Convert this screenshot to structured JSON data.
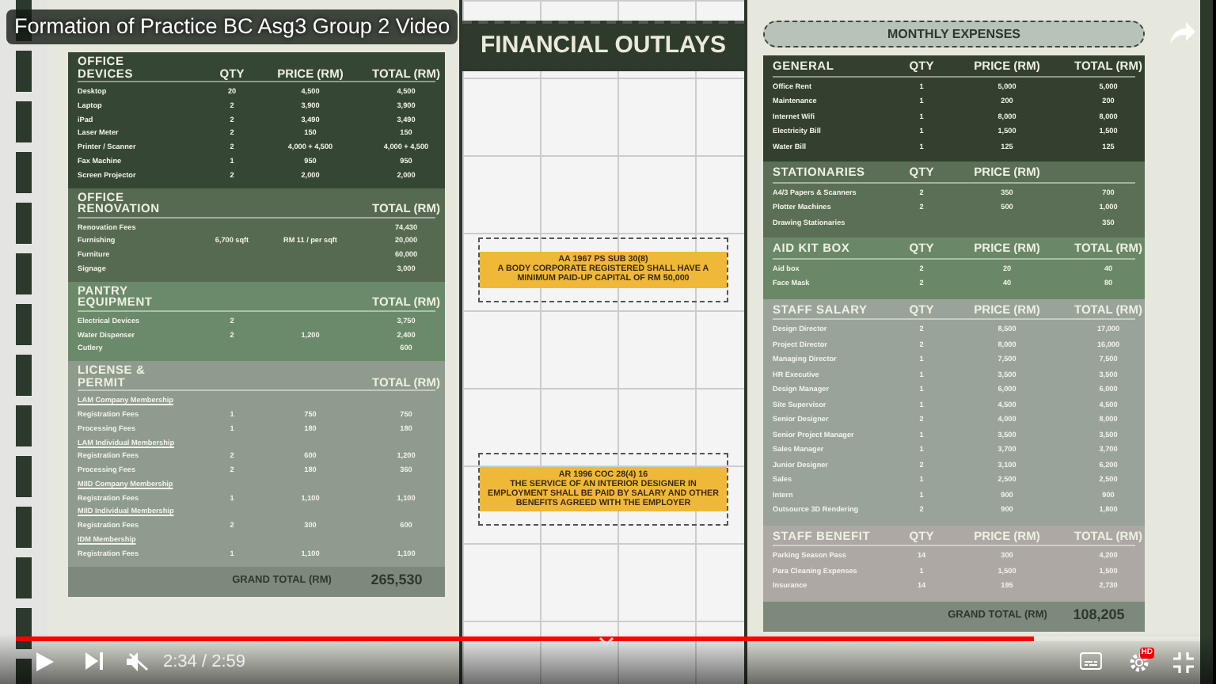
{
  "video": {
    "title": "Formation of Practice BC Asg3 Group 2 Video",
    "time": "2:34 / 2:59",
    "progress": {
      "level": 0.86
    },
    "quality_badge": "HD"
  },
  "slide": {
    "left_table": {
      "sections": [
        {
          "title": "OFFICE DEVICES",
          "color": "#354634",
          "headers": {
            "qty": "QTY",
            "price": "PRICE (RM)",
            "total": "TOTAL (RM)"
          },
          "rows": [
            {
              "kind": "item",
              "cells": [
                "Desktop",
                "20",
                "4,500",
                "4,500"
              ]
            },
            {
              "kind": "item",
              "cells": [
                "Laptop",
                "2",
                "3,900",
                "3,900"
              ]
            },
            {
              "kind": "item",
              "cells": [
                "iPad",
                "2",
                "3,490",
                "3,490"
              ]
            },
            {
              "kind": "item",
              "cells": [
                "Laser Meter",
                "2",
                "150",
                "150"
              ]
            },
            {
              "kind": "item",
              "cells": [
                "Printer / Scanner",
                "2",
                "4,000 + 4,500",
                "4,000 + 4,500"
              ]
            },
            {
              "kind": "item",
              "cells": [
                "Fax Machine",
                "1",
                "950",
                "950"
              ]
            },
            {
              "kind": "item",
              "cells": [
                "Screen Projector",
                "2",
                "2,000",
                "2,000"
              ]
            }
          ]
        },
        {
          "title": "OFFICE RENOVATION",
          "color": "#566a51",
          "headers": {
            "total": "TOTAL (RM)"
          },
          "rows": [
            {
              "kind": "item",
              "cells": [
                "Renovation Fees",
                null,
                null,
                "74,430"
              ]
            },
            {
              "kind": "item",
              "cells": [
                "Furnishing",
                "6,700 sqft",
                "RM 11 / per sqft",
                "20,000"
              ]
            },
            {
              "kind": "item",
              "cells": [
                "Furniture",
                null,
                null,
                "60,000"
              ]
            },
            {
              "kind": "item",
              "cells": [
                "Signage",
                null,
                null,
                "3,000"
              ]
            }
          ]
        },
        {
          "title": "PANTRY EQUIPMENT",
          "color": "#6b8a6b",
          "headers": {
            "total": "TOTAL (RM)"
          },
          "rows": [
            {
              "kind": "item",
              "cells": [
                "Electrical Devices",
                "2",
                null,
                "3,750"
              ]
            },
            {
              "kind": "item",
              "cells": [
                "Water Dispenser",
                "2",
                "1,200",
                "2,400"
              ]
            },
            {
              "kind": "item",
              "cells": [
                "Cutlery",
                null,
                null,
                "600"
              ]
            }
          ]
        },
        {
          "title": "LICENSE & PERMIT",
          "color": "#8e9b8d",
          "headers": {
            "total": "TOTAL (RM)"
          },
          "rows": [
            {
              "kind": "subheading",
              "cells": [
                "LAM Company Membership"
              ]
            },
            {
              "kind": "item",
              "cells": [
                "Registration Fees",
                "1",
                "750",
                "750"
              ]
            },
            {
              "kind": "item",
              "cells": [
                "Processing Fees",
                "1",
                "180",
                "180"
              ]
            },
            {
              "kind": "subheading",
              "cells": [
                "LAM Individual Membership"
              ]
            },
            {
              "kind": "item",
              "cells": [
                "Registration Fees",
                "2",
                "600",
                "1,200"
              ]
            },
            {
              "kind": "item",
              "cells": [
                "Processing Fees",
                "2",
                "180",
                "360"
              ]
            },
            {
              "kind": "subheading",
              "cells": [
                "MIID Company Membership"
              ]
            },
            {
              "kind": "item",
              "cells": [
                "Registration Fees",
                "1",
                "1,100",
                "1,100"
              ]
            },
            {
              "kind": "subheading",
              "cells": [
                "MIID Individual Membership"
              ]
            },
            {
              "kind": "item",
              "cells": [
                "Registration Fees",
                "2",
                "300",
                "600"
              ]
            },
            {
              "kind": "subheading",
              "cells": [
                "IDM Membership"
              ]
            },
            {
              "kind": "item",
              "cells": [
                "Registration Fees",
                "1",
                "1,100",
                "1,100"
              ]
            }
          ]
        }
      ],
      "grand_total": {
        "label": "GRAND TOTAL (RM)",
        "value": "265,530"
      }
    },
    "banner": "FINANCIAL OUTLAYS",
    "notes": [
      {
        "heading": "AA 1967 PS SUB 30(8)",
        "text": "A BODY CORPORATE REGISTERED SHALL HAVE A MINIMUM PAID-UP CAPITAL OF RM 50,000"
      },
      {
        "heading": "AR 1996 COC 28(4) 16",
        "text": "THE SERVICE OF AN INTERIOR DESIGNER IN EMPLOYMENT SHALL BE PAID BY SALARY AND OTHER BENEFITS AGREED WITH THE EMPLOYER"
      }
    ],
    "right_title": "MONTHLY EXPENSES",
    "right_table": {
      "sections": [
        {
          "title": "GENERAL",
          "color": "#33402f",
          "headers": {
            "qty": "QTY",
            "price": "PRICE (RM)",
            "total": "TOTAL (RM)"
          },
          "rows": [
            {
              "kind": "item",
              "cells": [
                "Office Rent",
                "1",
                "5,000",
                "5,000"
              ]
            },
            {
              "kind": "item",
              "cells": [
                "Maintenance",
                "1",
                "200",
                "200"
              ]
            },
            {
              "kind": "item",
              "cells": [
                "Internet Wifi",
                "1",
                "8,000",
                "8,000"
              ]
            },
            {
              "kind": "item",
              "cells": [
                "Electricity Bill",
                "1",
                "1,500",
                "1,500"
              ]
            },
            {
              "kind": "item",
              "cells": [
                "Water Bill",
                "1",
                "125",
                "125"
              ]
            }
          ]
        },
        {
          "title": "STATIONARIES",
          "color": "#5a6f55",
          "headers": {
            "qty": "QTY",
            "price": "PRICE (RM)"
          },
          "rows": [
            {
              "kind": "item",
              "cells": [
                "A4/3 Papers & Scanners",
                "2",
                "350",
                "700"
              ]
            },
            {
              "kind": "item",
              "cells": [
                "Plotter Machines",
                "2",
                "500",
                "1,000"
              ]
            },
            {
              "kind": "item",
              "cells": [
                "Drawing Stationaries",
                null,
                null,
                "350"
              ]
            }
          ]
        },
        {
          "title": "AID KIT BOX",
          "color": "#6a8867",
          "headers": {
            "qty": "QTY",
            "price": "PRICE (RM)",
            "total": "TOTAL (RM)"
          },
          "rows": [
            {
              "kind": "item",
              "cells": [
                "Aid box",
                "2",
                "20",
                "40"
              ]
            },
            {
              "kind": "item",
              "cells": [
                "Face Mask",
                "2",
                "40",
                "80"
              ]
            }
          ]
        },
        {
          "title": "STAFF SALARY",
          "color": "#9aa39a",
          "headers": {
            "qty": "QTY",
            "price": "PRICE (RM)",
            "total": "TOTAL (RM)"
          },
          "rows": [
            {
              "kind": "item",
              "cells": [
                "Design Director",
                "2",
                "8,500",
                "17,000"
              ]
            },
            {
              "kind": "item",
              "cells": [
                "Project Director",
                "2",
                "8,000",
                "16,000"
              ]
            },
            {
              "kind": "item",
              "cells": [
                "Managing Director",
                "1",
                "7,500",
                "7,500"
              ]
            },
            {
              "kind": "item",
              "cells": [
                "HR Executive",
                "1",
                "3,500",
                "3,500"
              ]
            },
            {
              "kind": "item",
              "cells": [
                "Design Manager",
                "1",
                "6,000",
                "6,000"
              ]
            },
            {
              "kind": "item",
              "cells": [
                "Site Supervisor",
                "1",
                "4,500",
                "4,500"
              ]
            },
            {
              "kind": "item",
              "cells": [
                "Senior Designer",
                "2",
                "4,000",
                "8,000"
              ]
            },
            {
              "kind": "item",
              "cells": [
                "Senior Project Manager",
                "1",
                "3,500",
                "3,500"
              ]
            },
            {
              "kind": "item",
              "cells": [
                "Sales Manager",
                "1",
                "3,700",
                "3,700"
              ]
            },
            {
              "kind": "item",
              "cells": [
                "Junior Designer",
                "2",
                "3,100",
                "6,200"
              ]
            },
            {
              "kind": "item",
              "cells": [
                "Sales",
                "1",
                "2,500",
                "2,500"
              ]
            },
            {
              "kind": "item",
              "cells": [
                "Intern",
                "1",
                "900",
                "900"
              ]
            },
            {
              "kind": "item",
              "cells": [
                "Outsource 3D Rendering",
                "2",
                "900",
                "1,800"
              ]
            }
          ]
        },
        {
          "title": "STAFF BENEFIT",
          "color": "#aea8a5",
          "headers": {
            "qty": "QTY",
            "price": "PRICE (RM)",
            "total": "TOTAL (RM)"
          },
          "rows": [
            {
              "kind": "item",
              "cells": [
                "Parking Season Pass",
                "14",
                "300",
                "4,200"
              ]
            },
            {
              "kind": "item",
              "cells": [
                "Para Cleaning Expenses",
                "1",
                "1,500",
                "1,500"
              ]
            },
            {
              "kind": "item",
              "cells": [
                "Insurance",
                "14",
                "195",
                "2,730"
              ]
            }
          ]
        }
      ],
      "grand_total": {
        "label": "GRAND TOTAL (RM)",
        "value": "108,205"
      }
    }
  }
}
